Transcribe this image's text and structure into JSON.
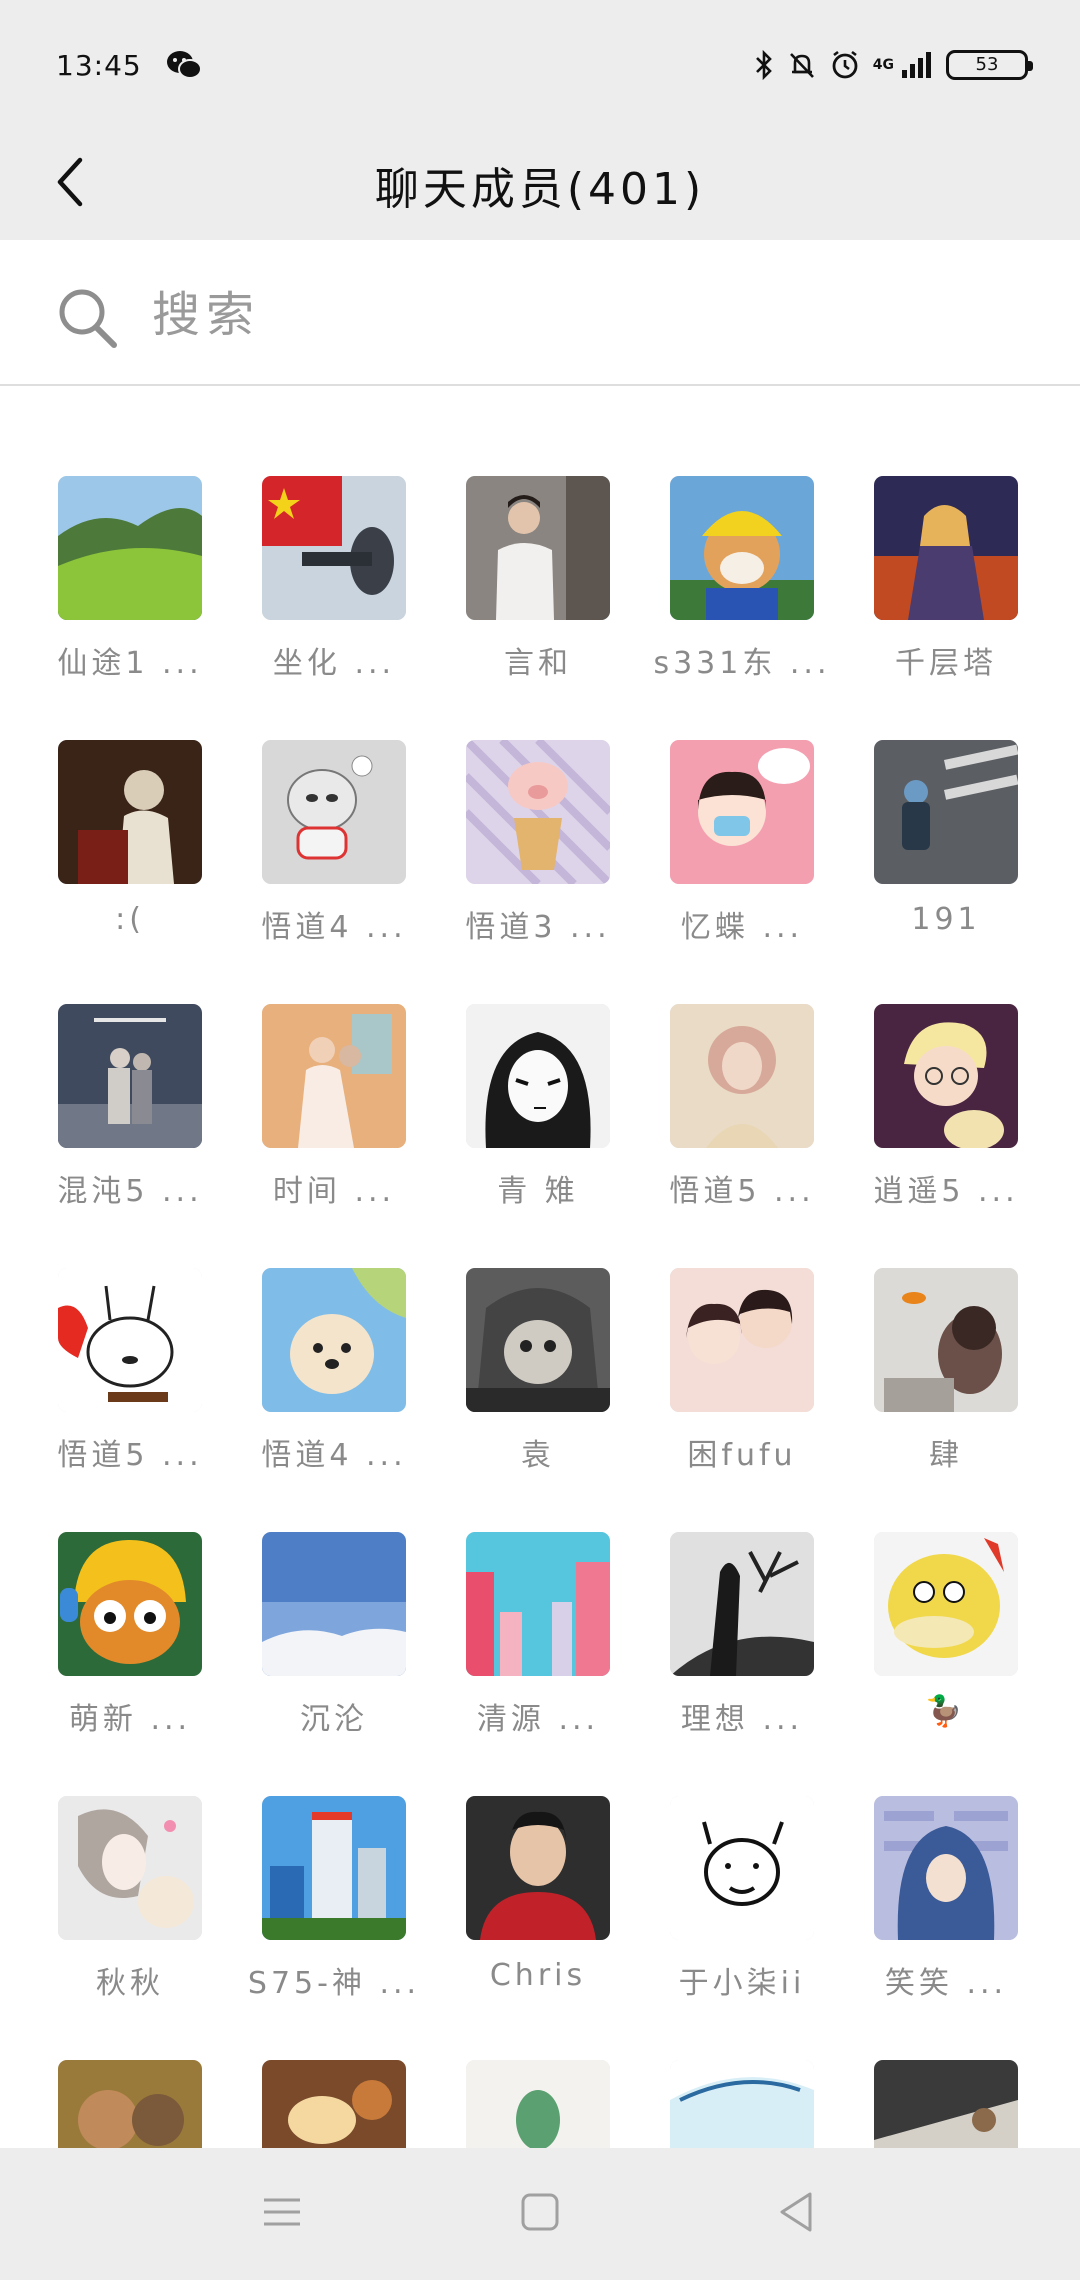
{
  "status": {
    "time": "13:45",
    "network": "4G",
    "battery": "53"
  },
  "header": {
    "title": "聊天成员(401)"
  },
  "search": {
    "placeholder": "搜索"
  },
  "members": [
    {
      "name": "仙途1 ...",
      "avatar": "grassy-hill"
    },
    {
      "name": "坐化 ...",
      "avatar": "flag-trumpet"
    },
    {
      "name": "言和",
      "avatar": "young-man-white-shirt"
    },
    {
      "name": "s331东 ...",
      "avatar": "shiba-dog-yellow-hat"
    },
    {
      "name": "千层塔",
      "avatar": "anime-girl-fire"
    },
    {
      "name": ":(",
      "avatar": "dark-portrait"
    },
    {
      "name": "悟道4 ...",
      "avatar": "cartoon-ultraman"
    },
    {
      "name": "悟道3 ...",
      "avatar": "pig-bubble-tea"
    },
    {
      "name": "忆蝶 ...",
      "avatar": "girl-face-mask"
    },
    {
      "name": "191",
      "avatar": "child-crosswalk"
    },
    {
      "name": "混沌5 ...",
      "avatar": "couple-night"
    },
    {
      "name": "时间 ...",
      "avatar": "wedding-couple"
    },
    {
      "name": "青 雉",
      "avatar": "manga-girl"
    },
    {
      "name": "悟道5 ...",
      "avatar": "blurred-girl"
    },
    {
      "name": "逍遥5 ...",
      "avatar": "blonde-cartoon"
    },
    {
      "name": "悟道5 ...",
      "avatar": "cartoon-rabbit"
    },
    {
      "name": "悟道4 ...",
      "avatar": "white-puppy"
    },
    {
      "name": "袁",
      "avatar": "cat-hood"
    },
    {
      "name": "困fufu",
      "avatar": "anime-couple"
    },
    {
      "name": "肆",
      "avatar": "boy-goldfish"
    },
    {
      "name": "萌新 ...",
      "avatar": "cartoon-yellow-beanie"
    },
    {
      "name": "沉沦",
      "avatar": "blue-sky-snow"
    },
    {
      "name": "清源 ...",
      "avatar": "pink-city"
    },
    {
      "name": "理想 ...",
      "avatar": "dark-tree-figure"
    },
    {
      "name": "🦆",
      "avatar": "psyduck"
    },
    {
      "name": "秋秋",
      "avatar": "sketch-girl-cat"
    },
    {
      "name": "S75-神 ...",
      "avatar": "skyscraper"
    },
    {
      "name": "Chris",
      "avatar": "man-red-shirt"
    },
    {
      "name": "于小柒ii",
      "avatar": "sketch-face"
    },
    {
      "name": "笑笑 ...",
      "avatar": "hooded-figure"
    },
    {
      "name": "",
      "avatar": "partial-1"
    },
    {
      "name": "",
      "avatar": "partial-2"
    },
    {
      "name": "",
      "avatar": "partial-3"
    },
    {
      "name": "",
      "avatar": "partial-4"
    },
    {
      "name": "",
      "avatar": "partial-5"
    }
  ],
  "icons": {
    "back": "chevron-left-icon",
    "search": "search-icon",
    "menu": "menu-icon",
    "home": "home-icon",
    "nav_back": "triangle-back-icon"
  }
}
